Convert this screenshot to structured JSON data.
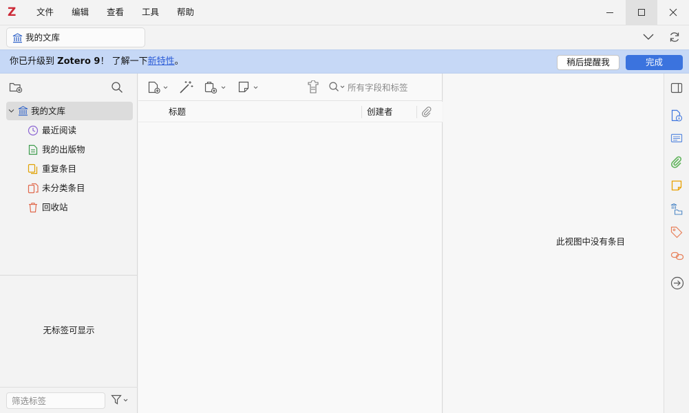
{
  "app": {
    "logo": "Z"
  },
  "menu": [
    {
      "label": "文件"
    },
    {
      "label": "编辑"
    },
    {
      "label": "查看"
    },
    {
      "label": "工具"
    },
    {
      "label": "帮助"
    }
  ],
  "tabs": {
    "library": {
      "label": "我的文库",
      "icon": "library-icon"
    }
  },
  "banner": {
    "prefix": "你已升级到 ",
    "product": "Zotero 9",
    "middle": "！ 了解一下",
    "link": "新特性",
    "suffix": "。",
    "remind_label": "稍后提醒我",
    "done_label": "完成"
  },
  "collections": [
    {
      "label": "我的文库",
      "icon": "library-icon",
      "selected": true
    },
    {
      "label": "最近阅读",
      "icon": "clock-icon"
    },
    {
      "label": "我的出版物",
      "icon": "publications-icon"
    },
    {
      "label": "重复条目",
      "icon": "duplicates-icon"
    },
    {
      "label": "未分类条目",
      "icon": "unfiled-icon"
    },
    {
      "label": "回收站",
      "icon": "trash-icon"
    }
  ],
  "tags": {
    "empty_message": "无标签可显示",
    "filter_placeholder": "筛选标签"
  },
  "items": {
    "search_placeholder": "所有字段和标签",
    "columns": {
      "title": "标题",
      "creator": "创建者"
    }
  },
  "item_pane": {
    "empty_message": "此视图中没有条目"
  },
  "colors": {
    "accent": "#3b73de",
    "banner": "#c6d8f6",
    "logo": "#cc2936",
    "link": "#2a5bd7"
  }
}
